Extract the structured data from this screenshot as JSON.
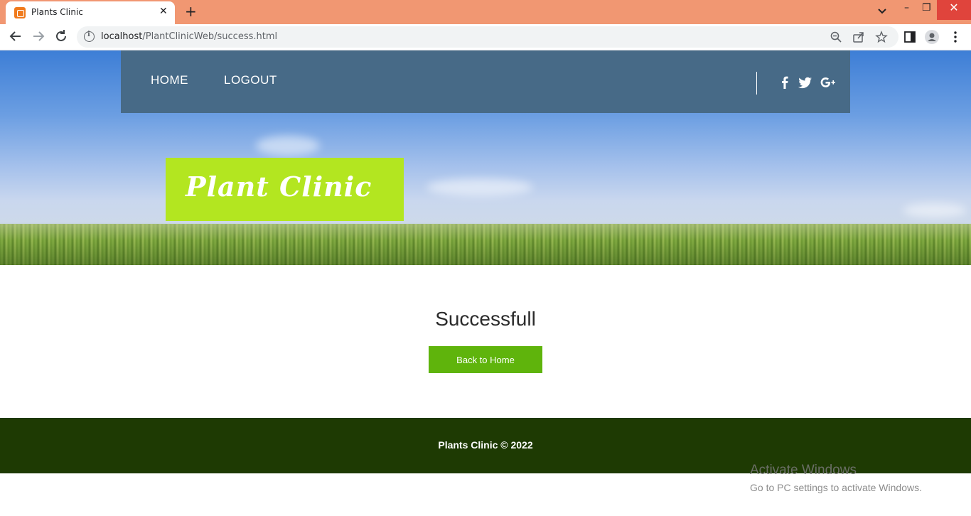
{
  "browser": {
    "tab_title": "Plants Clinic",
    "tab_close": "✕",
    "new_tab": "+",
    "url_host": "localhost",
    "url_path": "/PlantClinicWeb/success.html",
    "win_minimize": "–",
    "win_restore": "❐",
    "win_close": "✕"
  },
  "navbar": {
    "links": [
      "HOME",
      "LOGOUT"
    ],
    "social_icons": [
      "facebook-icon",
      "twitter-icon",
      "google-plus-icon"
    ]
  },
  "logo": {
    "text": "Plant Clinic"
  },
  "main": {
    "message": "Successfull",
    "button_label": "Back to Home"
  },
  "footer": {
    "text": "Plants Clinic © 2022"
  },
  "watermark": {
    "line1": "Activate Windows",
    "line2": "Go to PC settings to activate Windows."
  },
  "colors": {
    "tabbar": "#f19772",
    "navbar": "#476a87",
    "logo_bg": "#b3e620",
    "button": "#5fb40c",
    "footer": "#1e3a03"
  }
}
